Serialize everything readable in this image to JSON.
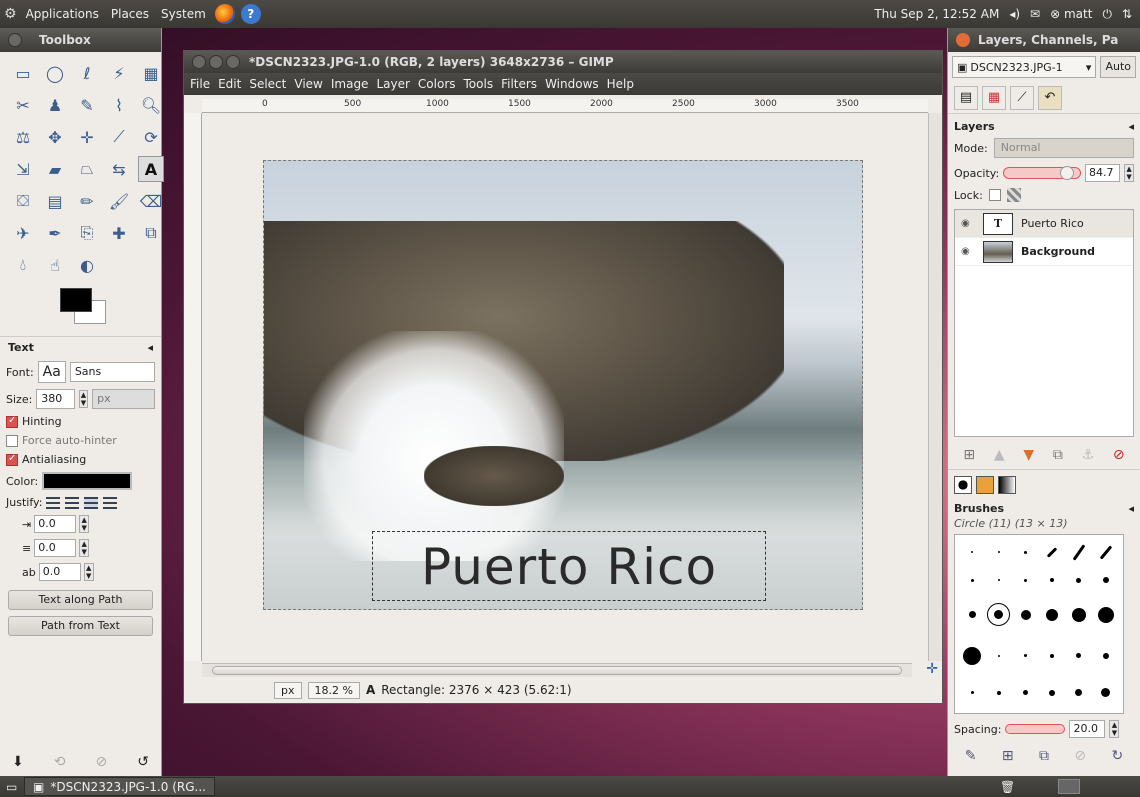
{
  "top_panel": {
    "menus": [
      "Applications",
      "Places",
      "System"
    ],
    "datetime": "Thu Sep  2, 12:52 AM",
    "user": "matt"
  },
  "toolbox": {
    "title": "Toolbox",
    "tool_icons": [
      "rect-select-icon",
      "ellipse-select-icon",
      "free-select-icon",
      "fuzzy-select-icon",
      "color-select-icon",
      "scissors-icon",
      "foreground-select-icon",
      "paths-icon",
      "color-picker-icon",
      "zoom-icon",
      "measure-icon",
      "move-icon",
      "align-icon",
      "crop-icon",
      "rotate-icon",
      "scale-icon",
      "shear-icon",
      "perspective-icon",
      "flip-icon",
      "text-icon",
      "bucket-fill-icon",
      "blend-icon",
      "pencil-icon",
      "paintbrush-icon",
      "eraser-icon",
      "airbrush-icon",
      "ink-icon",
      "clone-icon",
      "heal-icon",
      "perspective-clone-icon",
      "blur-icon",
      "smudge-icon",
      "dodge-icon"
    ],
    "options": {
      "section": "Text",
      "font_label": "Font:",
      "font_preview": "Aa",
      "font_value": "Sans",
      "size_label": "Size:",
      "size_value": "380",
      "size_unit": "px",
      "hinting": "Hinting",
      "force_autohinter": "Force auto-hinter",
      "antialiasing": "Antialiasing",
      "color_label": "Color:",
      "justify_label": "Justify:",
      "indent": "0.0",
      "line_spacing": "0.0",
      "letter_spacing": "0.0",
      "text_along_path": "Text along Path",
      "path_from_text": "Path from Text"
    }
  },
  "image_window": {
    "title": "*DSCN2323.JPG-1.0 (RGB, 2 layers) 3648x2736 – GIMP",
    "menus": [
      "File",
      "Edit",
      "Select",
      "View",
      "Image",
      "Layer",
      "Colors",
      "Tools",
      "Filters",
      "Windows",
      "Help"
    ],
    "ruler_marks": [
      "0",
      "500",
      "1000",
      "1500",
      "2000",
      "2500",
      "3000",
      "3500"
    ],
    "text_layer": "Puerto Rico",
    "status": {
      "unit": "px",
      "zoom": "18.2 %",
      "message": "Rectangle: 2376 × 423  (5.62:1)"
    }
  },
  "dock": {
    "title": "Layers, Channels, Pa",
    "image_selector": "DSCN2323.JPG-1",
    "auto_button": "Auto",
    "layers_label": "Layers",
    "mode_label": "Mode:",
    "mode_value": "Normal",
    "opacity_label": "Opacity:",
    "opacity_value": "84.7",
    "lock_label": "Lock:",
    "layers": [
      {
        "name": "Puerto Rico",
        "type": "text"
      },
      {
        "name": "Background",
        "type": "image"
      }
    ],
    "brushes_label": "Brushes",
    "brush_selected": "Circle (11) (13 × 13)",
    "spacing_label": "Spacing:",
    "spacing_value": "20.0"
  },
  "taskbar": {
    "window_button": "*DSCN2323.JPG-1.0 (RG..."
  }
}
